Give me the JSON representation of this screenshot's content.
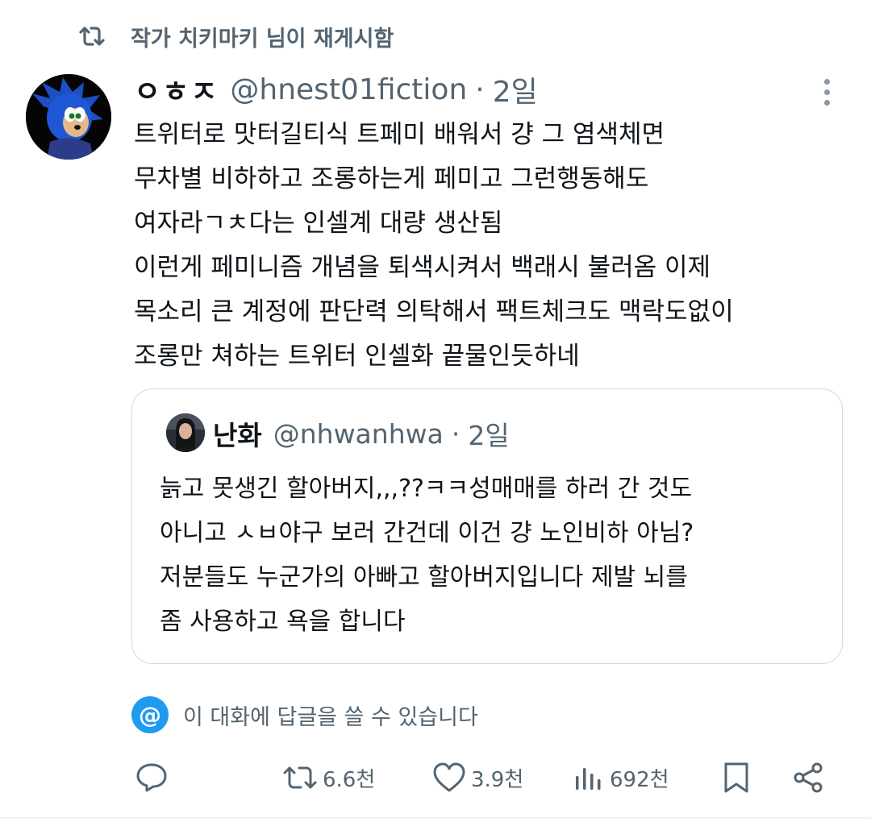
{
  "retweet_banner": {
    "text": "작가 치키마키 님이 재게시함",
    "icon": "repost-icon"
  },
  "tweet": {
    "author": {
      "display_name": "ㅇㅎㅈ",
      "handle": "@hnest01fiction",
      "avatar_icon": "sonic-avatar"
    },
    "separator": "·",
    "time": "2일",
    "lines": [
      "트위터로 맛터길티식 트페미 배워서 걍 그 염색체면",
      "무차별 비하하고 조롱하는게 페미고 그런행동해도",
      "여자라ㄱㅊ다는 인셀계 대량 생산됨",
      "이런게 페미니즘 개념을 퇴색시켜서 백래시 불러옴 이제",
      "목소리 큰 계정에 판단력 의탁해서 팩트체크도 맥락도없이",
      "조롱만 쳐하는 트위터 인셀화 끝물인듯하네"
    ]
  },
  "quoted_tweet": {
    "author": {
      "display_name": "난화",
      "handle": "@nhwanhwa",
      "avatar_icon": "profile-photo"
    },
    "separator": "·",
    "time": "2일",
    "lines": [
      "늙고 못생긴 할아버지,,,??ㅋㅋ성매매를 하러 간 것도",
      "아니고 ㅅㅂ야구 보러 간건데 이건 걍 노인비하 아님?",
      "저분들도 누군가의 아빠고 할아버지입니다 제발 뇌를",
      "좀 사용하고 욕을 합니다"
    ]
  },
  "reply_notice": {
    "symbol": "@",
    "text": "이 대화에 답글을 쓸 수 있습니다"
  },
  "actions": {
    "reply": {
      "icon": "reply-icon"
    },
    "repost": {
      "icon": "repost-icon",
      "count": "6.6천"
    },
    "like": {
      "icon": "heart-icon",
      "count": "3.9천"
    },
    "views": {
      "icon": "views-icon",
      "count": "692천"
    },
    "bookmark": {
      "icon": "bookmark-icon"
    },
    "share": {
      "icon": "share-icon"
    }
  },
  "colors": {
    "text_primary": "#0f1419",
    "text_secondary": "#536471",
    "accent": "#1d9bf0",
    "border": "#cfd9de"
  }
}
